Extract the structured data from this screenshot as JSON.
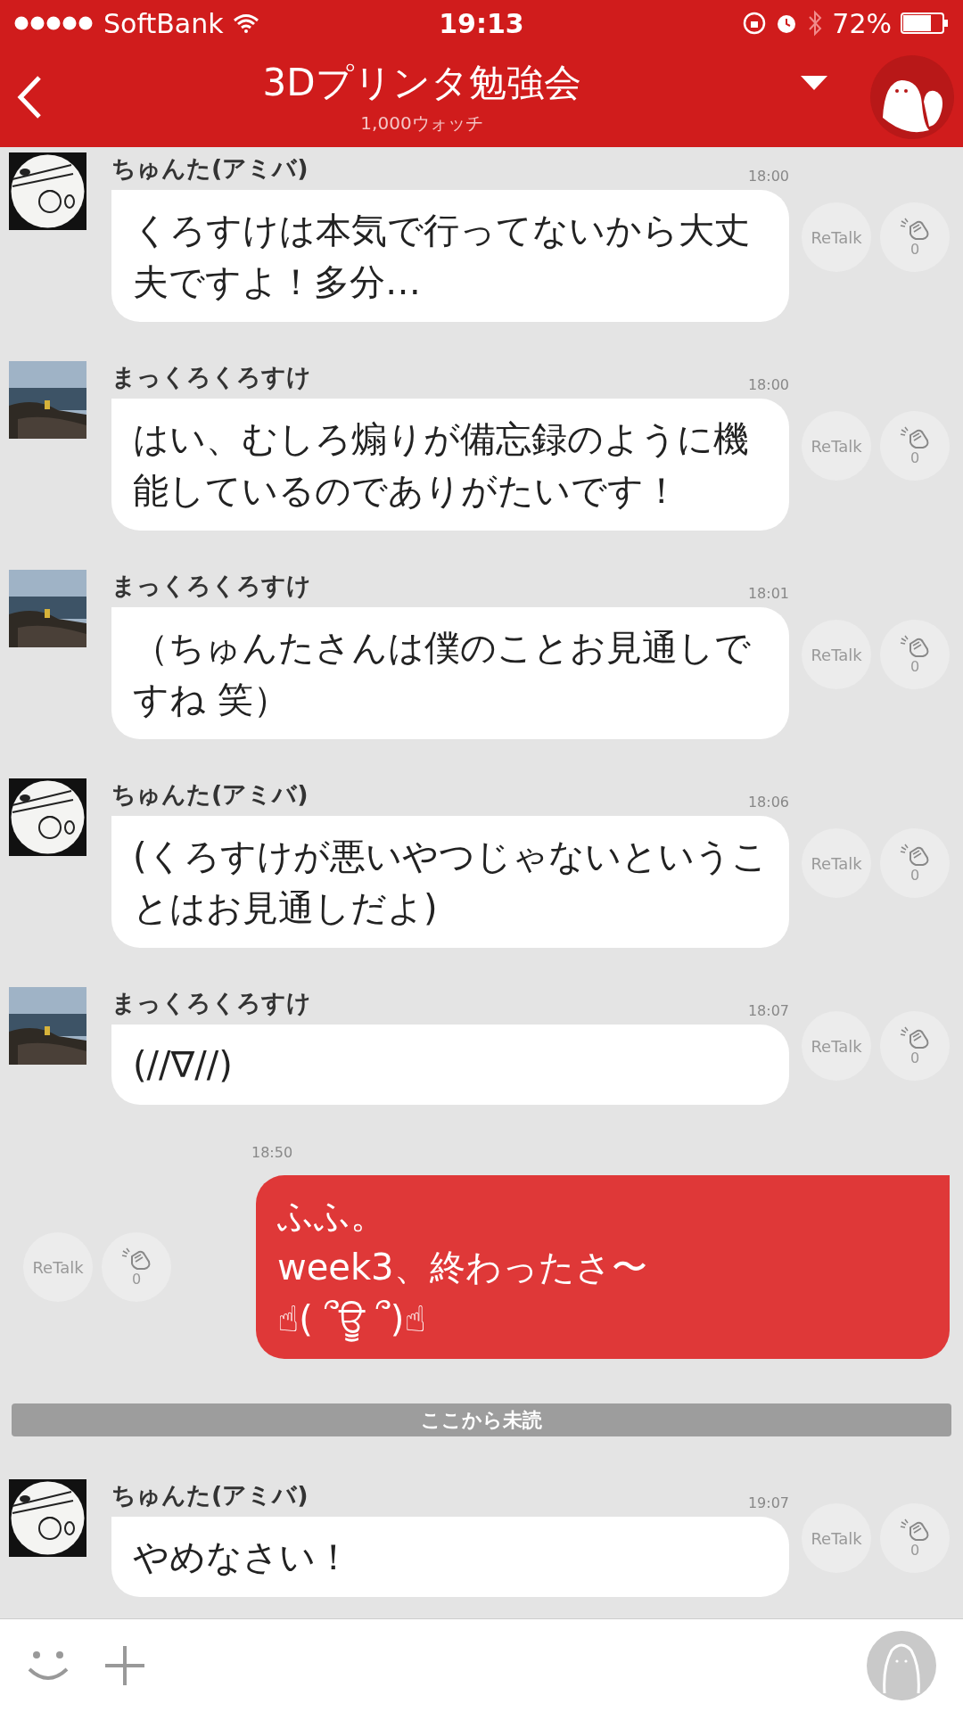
{
  "status_bar": {
    "carrier": "SoftBank",
    "time": "19:13",
    "battery": "72%"
  },
  "header": {
    "title": "3Dプリンタ勉強会",
    "subtitle": "1,000ウォッチ"
  },
  "messages": [
    {
      "kind": "incoming",
      "sender": "ちゅんた(アミバ)",
      "time": "18:00",
      "text": "くろすけは本気で行ってないから大丈夫ですよ！多分…",
      "retalk": "ReTalk",
      "claps": "0"
    },
    {
      "kind": "incoming",
      "sender": "まっくろくろすけ",
      "time": "18:00",
      "text": "はい、むしろ煽りが備忘録のように機能しているのでありがたいです！",
      "retalk": "ReTalk",
      "claps": "0"
    },
    {
      "kind": "incoming",
      "sender": "まっくろくろすけ",
      "time": "18:01",
      "text": "（ちゅんたさんは僕のことお見通しですね 笑）",
      "retalk": "ReTalk",
      "claps": "0"
    },
    {
      "kind": "incoming",
      "sender": "ちゅんた(アミバ)",
      "time": "18:06",
      "text": "(くろすけが悪いやつじゃないということはお見通しだよ)",
      "retalk": "ReTalk",
      "claps": "0"
    },
    {
      "kind": "incoming",
      "sender": "まっくろくろすけ",
      "time": "18:07",
      "text": "(//∇//)",
      "retalk": "ReTalk",
      "claps": "0"
    },
    {
      "kind": "outgoing",
      "time": "18:50",
      "text": "ふふ。\nweek3、終わったさ〜\n☝( ՞ਊ ՞)☝",
      "retalk": "ReTalk",
      "claps": "0"
    },
    {
      "kind": "divider",
      "text": "ここから未読"
    },
    {
      "kind": "incoming",
      "sender": "ちゅんた(アミバ)",
      "time": "19:07",
      "text": "やめなさい！",
      "retalk": "ReTalk",
      "claps": "0"
    }
  ]
}
